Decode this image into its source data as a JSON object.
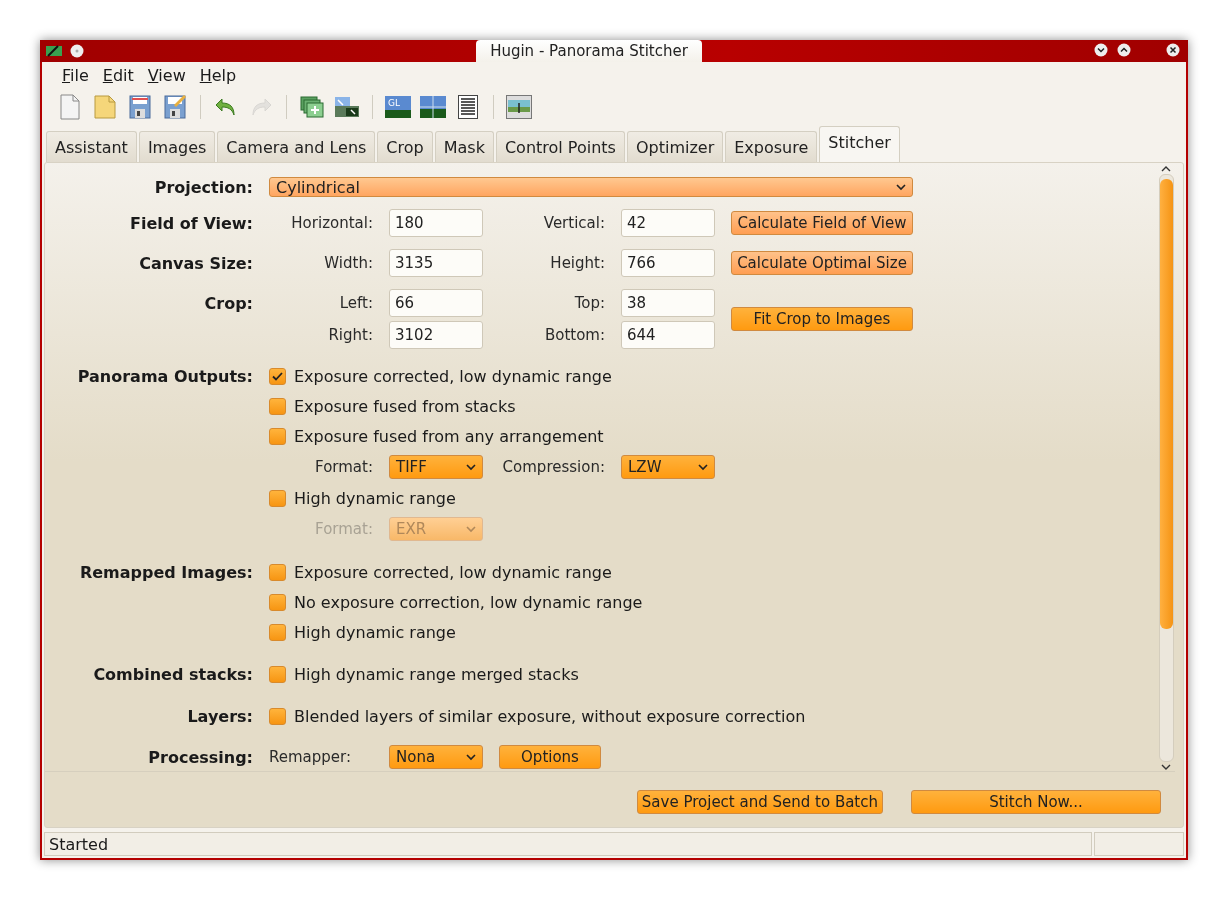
{
  "window": {
    "title": "Hugin - Panorama Stitcher"
  },
  "menu": [
    {
      "label": "File"
    },
    {
      "label": "Edit"
    },
    {
      "label": "View"
    },
    {
      "label": "Help"
    }
  ],
  "toolbar": [
    {
      "kind": "new",
      "disabled": false
    },
    {
      "kind": "open",
      "disabled": false
    },
    {
      "kind": "save",
      "disabled": false
    },
    {
      "kind": "save-as",
      "disabled": false
    },
    {
      "kind": "separator"
    },
    {
      "kind": "undo",
      "disabled": false
    },
    {
      "kind": "redo",
      "disabled": true
    },
    {
      "kind": "separator"
    },
    {
      "kind": "add-images",
      "disabled": false
    },
    {
      "kind": "align",
      "disabled": false
    },
    {
      "kind": "separator"
    },
    {
      "kind": "gl-preview",
      "disabled": false,
      "label": "GL"
    },
    {
      "kind": "preview",
      "disabled": false
    },
    {
      "kind": "list",
      "disabled": false
    },
    {
      "kind": "separator"
    },
    {
      "kind": "batch",
      "disabled": false
    }
  ],
  "tabs": [
    {
      "label": "Assistant",
      "selected": false
    },
    {
      "label": "Images",
      "selected": false
    },
    {
      "label": "Camera and Lens",
      "selected": false
    },
    {
      "label": "Crop",
      "selected": false
    },
    {
      "label": "Mask",
      "selected": false
    },
    {
      "label": "Control Points",
      "selected": false
    },
    {
      "label": "Optimizer",
      "selected": false
    },
    {
      "label": "Exposure",
      "selected": false
    },
    {
      "label": "Stitcher",
      "selected": true
    }
  ],
  "sections": [
    {
      "kind": "dropdown",
      "label": "Projection:",
      "value": "Cylindrical"
    },
    {
      "kind": "fields",
      "label": "Field of View:",
      "rows": [
        [
          {
            "label": "Horizontal:",
            "value": "180"
          },
          {
            "label": "Vertical:",
            "value": "42"
          }
        ]
      ],
      "button": "Calculate Field of View"
    },
    {
      "kind": "fields",
      "label": "Canvas Size:",
      "rows": [
        [
          {
            "label": "Width:",
            "value": "3135"
          },
          {
            "label": "Height:",
            "value": "766"
          }
        ]
      ],
      "button": "Calculate Optimal Size"
    },
    {
      "kind": "fields",
      "label": "Crop:",
      "rows": [
        [
          {
            "label": "Left:",
            "value": "66"
          },
          {
            "label": "Top:",
            "value": "38"
          }
        ],
        [
          {
            "label": "Right:",
            "value": "3102"
          },
          {
            "label": "Bottom:",
            "value": "644"
          }
        ]
      ],
      "button": "Fit Crop to Images"
    },
    {
      "kind": "checks",
      "label": "Panorama Outputs:",
      "items": [
        {
          "kind": "checkbox",
          "label": "Exposure corrected, low dynamic range",
          "checked": true
        },
        {
          "kind": "checkbox",
          "label": "Exposure fused from stacks",
          "checked": false
        },
        {
          "kind": "checkbox",
          "label": "Exposure fused from any arrangement",
          "checked": false
        },
        {
          "kind": "format",
          "label": "Format:",
          "value": "TIFF",
          "disabled": false,
          "extra_label": "Compression:",
          "extra_value": "LZW"
        },
        {
          "kind": "checkbox",
          "label": "High dynamic range",
          "checked": false
        },
        {
          "kind": "format",
          "label": "Format:",
          "value": "EXR",
          "disabled": true
        }
      ]
    },
    {
      "kind": "checks",
      "label": "Remapped Images:",
      "items": [
        {
          "kind": "checkbox",
          "label": "Exposure corrected, low dynamic range",
          "checked": false
        },
        {
          "kind": "checkbox",
          "label": "No exposure correction, low dynamic range",
          "checked": false
        },
        {
          "kind": "checkbox",
          "label": "High dynamic range",
          "checked": false
        }
      ]
    },
    {
      "kind": "checks",
      "label": "Combined stacks:",
      "items": [
        {
          "kind": "checkbox",
          "label": "High dynamic range merged stacks",
          "checked": false
        }
      ]
    },
    {
      "kind": "checks",
      "label": "Layers:",
      "items": [
        {
          "kind": "checkbox",
          "label": "Blended layers of similar exposure, without exposure correction",
          "checked": false
        }
      ]
    },
    {
      "kind": "processing",
      "label": "Processing:",
      "sub_label": "Remapper:",
      "value": "Nona",
      "button": "Options"
    }
  ],
  "actions": [
    "Save Project and Send to Batch",
    "Stitch Now..."
  ],
  "status_bar": {
    "text": "Started"
  }
}
